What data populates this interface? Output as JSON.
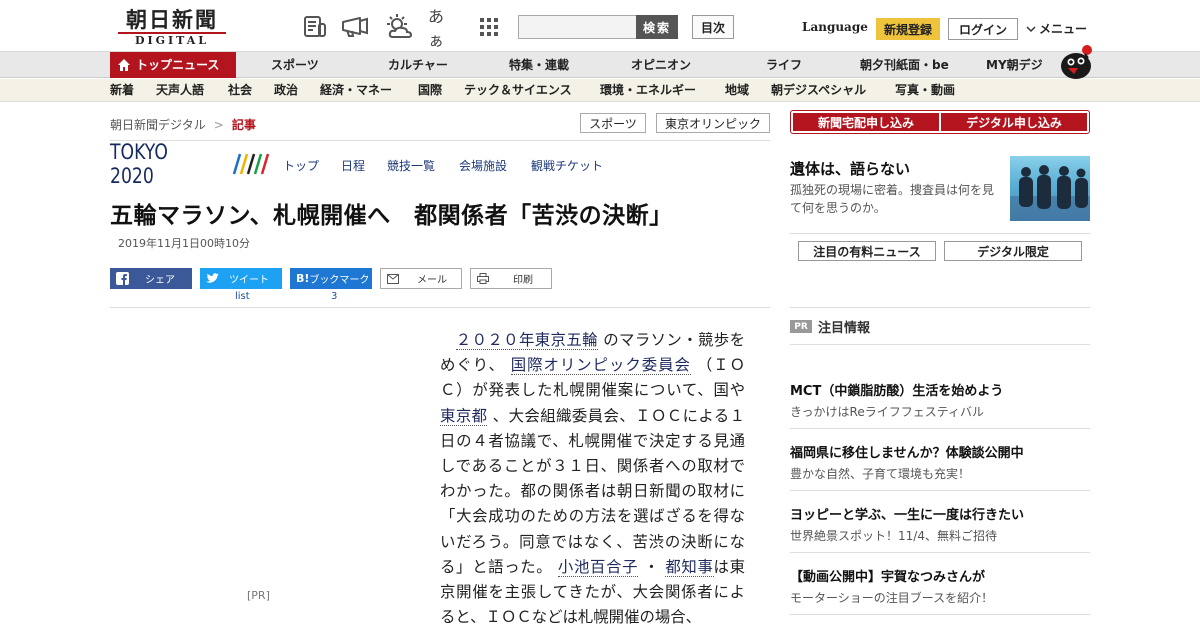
{
  "header": {
    "logo_jp": "朝日新聞",
    "logo_en": "DIGITAL",
    "search_button": "検索",
    "toc_button": "目次",
    "language": "Language",
    "register": "新規登録",
    "login": "ログイン",
    "menu": "メニュー",
    "icons": [
      "newspaper-icon",
      "megaphone-icon",
      "weather-icon",
      "font-size-icon",
      "grid-icon"
    ],
    "font_icon_text": "あぁ"
  },
  "nav_primary": [
    "トップニュース",
    "スポーツ",
    "カルチャー",
    "特集・連載",
    "オピニオン",
    "ライフ",
    "朝夕刊紙面・be",
    "MY朝デジ"
  ],
  "nav_secondary": [
    "新着",
    "天声人語",
    "社会",
    "政治",
    "経済・マネー",
    "国際",
    "テック＆サイエンス",
    "環境・エネルギー",
    "地域",
    "朝デジスペシャル",
    "写真・動画"
  ],
  "breadcrumb": {
    "home": "朝日新聞デジタル",
    "separator": ">",
    "current": "記事"
  },
  "tags": [
    "スポーツ",
    "東京オリンピック"
  ],
  "tokyo2020": {
    "logo": "TOKYO 2020",
    "links": [
      "トップ",
      "日程",
      "競技一覧",
      "会場施設",
      "観戦チケット"
    ]
  },
  "article": {
    "headline": "五輪マラソン、札幌開催へ　都関係者「苦渋の決断」",
    "date": "2019年11月1日00時10分",
    "pr_label": "[PR]",
    "body": {
      "indent": "　",
      "link_1": "２０２０年東京五輪",
      "t1": "のマラソン・競歩をめぐり、",
      "link_2": "国際オリンピック委員会",
      "t2": "（ＩＯＣ）が発表した札幌開催案について、国や",
      "link_3": "東京都",
      "t3": "、大会組織委員会、ＩＯＣによる１日の４者協議で、札幌開催で決定する見通しであることが３１日、関係者への取材でわかった。都の関係者は朝日新聞の取材に「大会成功のための方法を選ばざるを得ないだろう。同意ではなく、苦渋の決断になる」と語った。",
      "link_4": "小池百合子",
      "t4": "・",
      "link_5": "都知事",
      "t5": "は東京開催を主張してきたが、大会関係者によると、ＩＯＣなどは札幌開催の場合、"
    }
  },
  "share": {
    "facebook": "シェア",
    "twitter": "ツイート",
    "twitter_count": "list",
    "hatena_logo": "B!",
    "hatena": "ブックマーク",
    "hatena_count": "3",
    "mail": "メール",
    "print": "印刷"
  },
  "sidebar": {
    "subscribe_paper": "新聞宅配申し込み",
    "subscribe_digital": "デジタル申し込み",
    "feature_title": "遺体は、語らない",
    "feature_desc": "孤独死の現場に密着。捜査員は何を見て何を思うのか。",
    "tab_paid": "注目の有料ニュース",
    "tab_digital": "デジタル限定",
    "pr_badge": "PR",
    "pr_heading": "注目情報",
    "ads": [
      {
        "title": "MCT（中鎖脂肪酸）生活を始めよう",
        "desc": "きっかけはReライフフェスティバル"
      },
      {
        "title": "福岡県に移住しませんか？体験談公開中",
        "desc": "豊かな自然、子育て環境も充実！"
      },
      {
        "title": "ヨッピーと学ぶ、一生に一度は行きたい",
        "desc": "世界絶景スポット！11/4、無料ご招待"
      },
      {
        "title": "【動画公開中】宇賀なつみさんが",
        "desc": "モーターショーの注目ブースを紹介！"
      }
    ]
  },
  "colors": {
    "brand_red": "#b4141e",
    "register_yellow": "#f0c33c",
    "facebook": "#3b5998",
    "twitter": "#1da1f2",
    "hatena": "#1f77d4",
    "tokyo_navy": "#152a5e"
  }
}
